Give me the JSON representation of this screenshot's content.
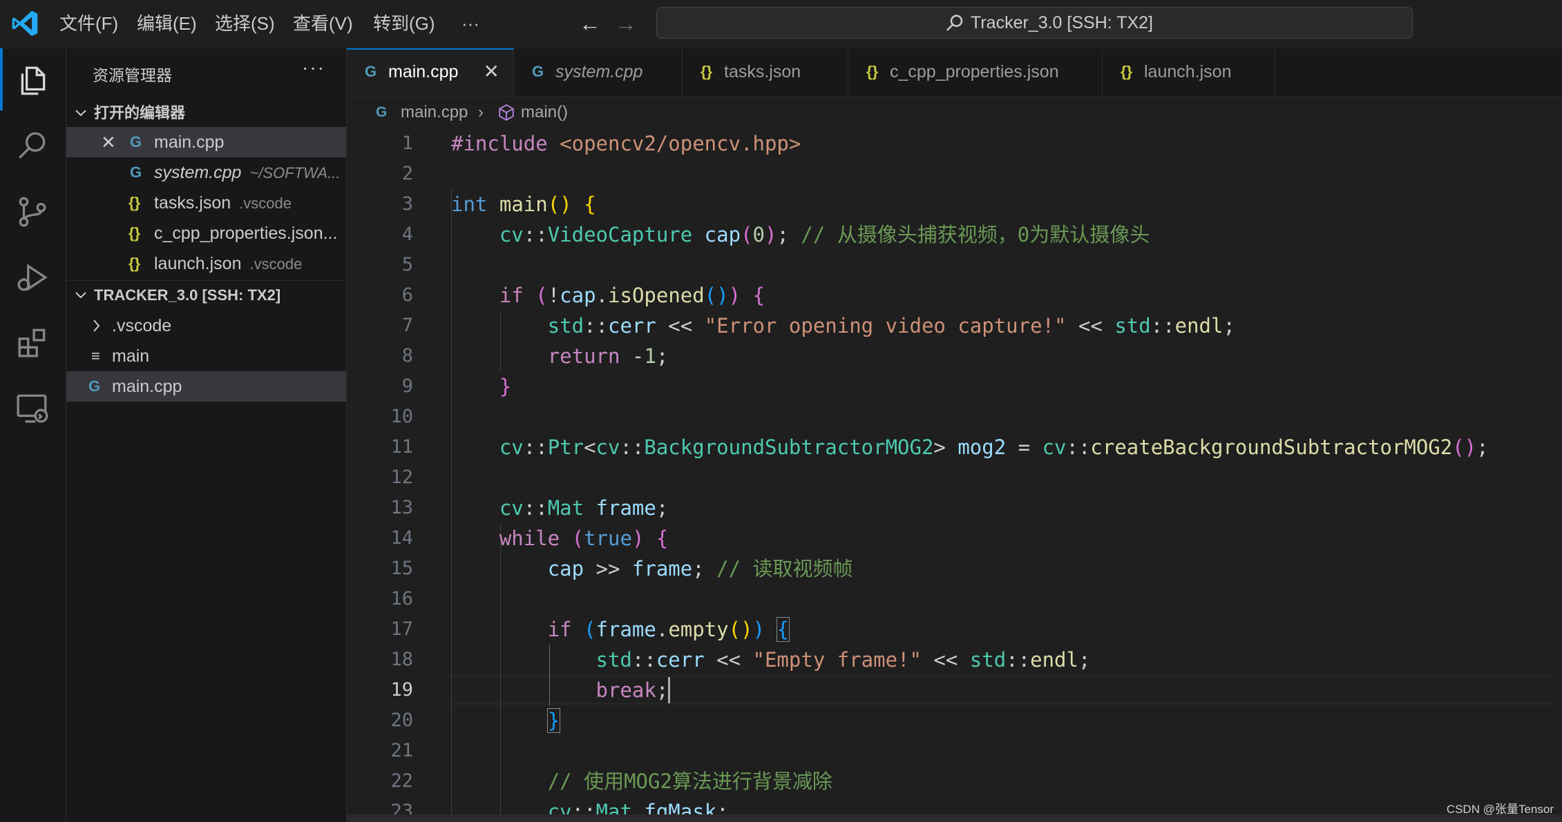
{
  "titlebar": {
    "menus": [
      "文件(F)",
      "编辑(E)",
      "选择(S)",
      "查看(V)",
      "转到(G)",
      "···"
    ],
    "command_center": "Tracker_3.0 [SSH: TX2]",
    "back_glyph": "←",
    "forward_glyph": "→"
  },
  "activitybar": {
    "items": [
      "explorer-icon",
      "search-icon",
      "source-control-icon",
      "run-debug-icon",
      "extensions-icon",
      "remote-explorer-icon"
    ]
  },
  "sidebar": {
    "title": "资源管理器",
    "more": "···",
    "open_editors": {
      "header": "打开的编辑器",
      "items": [
        {
          "icon": "G",
          "name": "main.cpp",
          "desc": "",
          "close": "✕"
        },
        {
          "icon": "G",
          "name": "system.cpp",
          "desc": "~/SOFTWA..."
        },
        {
          "icon": "{}",
          "name": "tasks.json",
          "desc": ".vscode"
        },
        {
          "icon": "{}",
          "name": "c_cpp_properties.json...",
          "desc": ""
        },
        {
          "icon": "{}",
          "name": "launch.json",
          "desc": ".vscode"
        }
      ]
    },
    "workspace": {
      "header": "TRACKER_3.0 [SSH: TX2]",
      "items": [
        {
          "icon": "›",
          "name": ".vscode"
        },
        {
          "icon": "≡",
          "name": "main"
        },
        {
          "icon": "G",
          "name": "main.cpp"
        }
      ]
    }
  },
  "tabs": [
    {
      "icon": "G",
      "label": "main.cpp",
      "close": "✕"
    },
    {
      "icon": "G",
      "label": "system.cpp"
    },
    {
      "icon": "{}",
      "label": "tasks.json"
    },
    {
      "icon": "{}",
      "label": "c_cpp_properties.json"
    },
    {
      "icon": "{}",
      "label": "launch.json"
    }
  ],
  "breadcrumb": {
    "file": "main.cpp",
    "sep": "›",
    "symbol": "main()"
  },
  "editor": {
    "current_line": 19,
    "line_numbers": [
      "1",
      "2",
      "3",
      "4",
      "5",
      "6",
      "7",
      "8",
      "9",
      "10",
      "11",
      "12",
      "13",
      "14",
      "15",
      "16",
      "17",
      "18",
      "19",
      "20",
      "21",
      "22",
      "23"
    ]
  },
  "watermark": "CSDN @张量Tensor",
  "colors": {
    "accent": "#0078d4",
    "keyword": "#569cd6",
    "control": "#c586c0",
    "type": "#4ec9b0",
    "function": "#dcdcaa",
    "variable": "#9cdcfe",
    "string": "#ce9178",
    "number": "#b5cea8",
    "comment": "#6a9955"
  }
}
